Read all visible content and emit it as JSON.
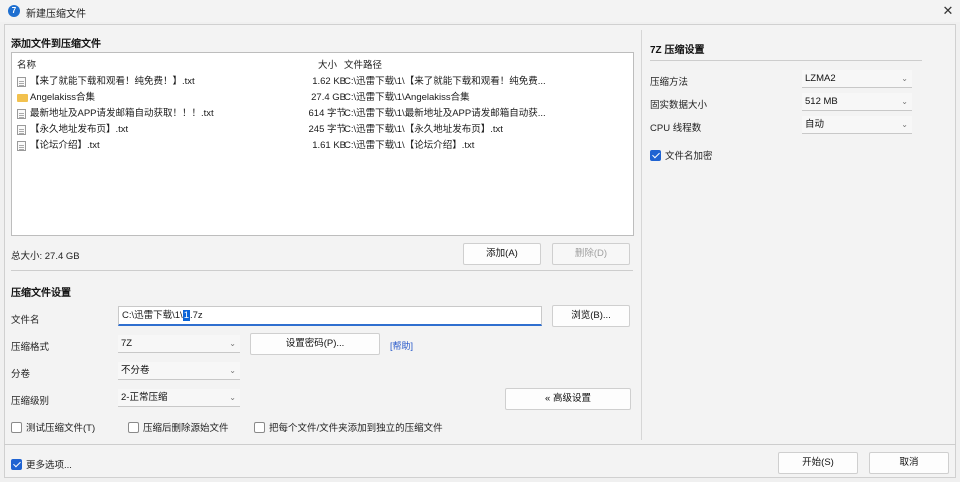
{
  "window": {
    "title": "新建压缩文件",
    "app_icon": "7z-icon"
  },
  "add_files": {
    "section_title": "添加文件到压缩文件",
    "columns": {
      "name": "名称",
      "size": "大小",
      "path": "文件路径"
    },
    "rows": [
      {
        "icon": "document-icon",
        "name": "【来了就能下载和观看！纯免费！】.txt",
        "size": "1.62 KB",
        "path": "C:\\迅雷下载\\1\\【来了就能下载和观看！纯免费..."
      },
      {
        "icon": "folder-icon",
        "name": "Angelakiss合集",
        "size": "27.4 GB",
        "path": "C:\\迅雷下载\\1\\Angelakiss合集"
      },
      {
        "icon": "document-icon",
        "name": "最新地址及APP请发邮箱自动获取！！！.txt",
        "size": "614 字节",
        "path": "C:\\迅雷下载\\1\\最新地址及APP请发邮箱自动获..."
      },
      {
        "icon": "document-icon",
        "name": "【永久地址发布页】.txt",
        "size": "245 字节",
        "path": "C:\\迅雷下载\\1\\【永久地址发布页】.txt"
      },
      {
        "icon": "document-icon",
        "name": "【论坛介绍】.txt",
        "size": "1.61 KB",
        "path": "C:\\迅雷下载\\1\\【论坛介绍】.txt"
      }
    ],
    "total_label": "总大小: 27.4 GB",
    "add_button": "添加(A)",
    "remove_button": "删除(D)"
  },
  "archive_settings": {
    "section_title": "压缩文件设置",
    "filename_label": "文件名",
    "filename_prefix": "C:\\迅雷下载\\1\\",
    "filename_selected": "1",
    "filename_suffix": ".7z",
    "browse_button": "浏览(B)...",
    "format_label": "压缩格式",
    "format_value": "7Z",
    "set_password_button": "设置密码(P)...",
    "help_link": "[帮助]",
    "split_label": "分卷",
    "split_value": "不分卷",
    "level_label": "压缩级别",
    "level_value": "2-正常压缩",
    "advanced_button": "« 高级设置",
    "options": [
      {
        "label": "测试压缩文件(T)",
        "checked": false
      },
      {
        "label": "压缩后删除源始文件",
        "checked": false
      },
      {
        "label": "把每个文件/文件夹添加到独立的压缩文件",
        "checked": false
      }
    ]
  },
  "right_panel": {
    "title": "7Z 压缩设置",
    "method_label": "压缩方法",
    "method_value": "LZMA2",
    "dict_label": "固实数据大小",
    "dict_value": "512 MB",
    "threads_label": "CPU 线程数",
    "threads_value": "自动",
    "encrypt_names_label": "文件名加密",
    "encrypt_names_checked": true
  },
  "footer": {
    "more_options_label": "更多选项...",
    "more_options_checked": true,
    "start_button": "开始(S)",
    "cancel_button": "取消"
  },
  "colors": {
    "accent": "#1f63d2",
    "link": "#2355c9",
    "selection": "#0a64d8"
  }
}
